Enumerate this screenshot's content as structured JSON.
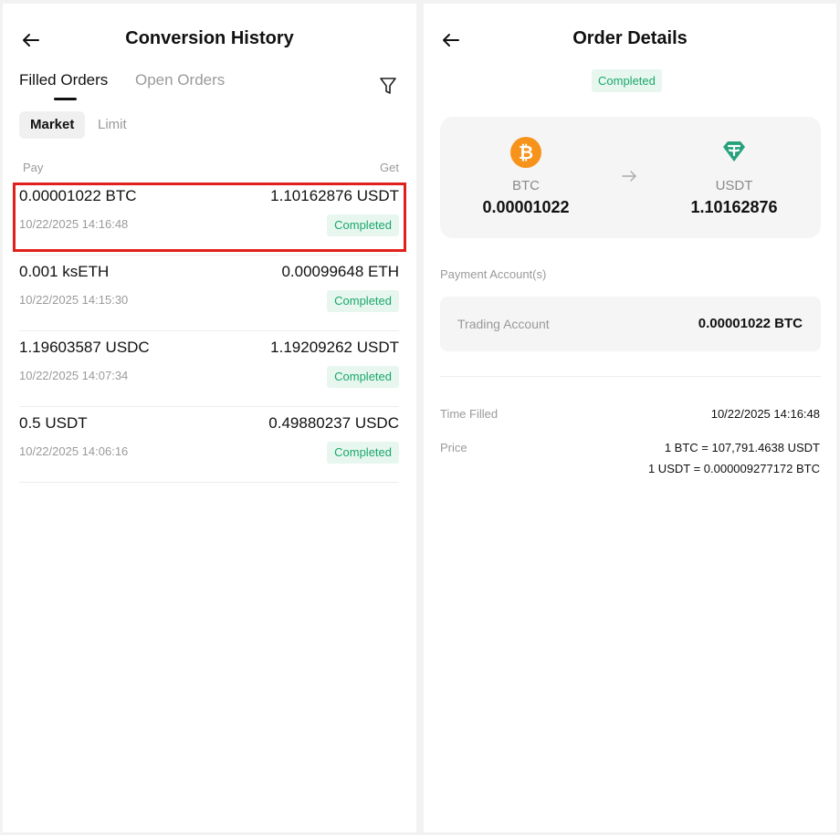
{
  "history": {
    "title": "Conversion History",
    "tabs": [
      "Filled Orders",
      "Open Orders"
    ],
    "filters": [
      "Market",
      "Limit"
    ],
    "columns": {
      "pay": "Pay",
      "get": "Get"
    },
    "rows": [
      {
        "pay": "0.00001022 BTC",
        "get": "1.10162876 USDT",
        "time": "10/22/2025 14:16:48",
        "status": "Completed"
      },
      {
        "pay": "0.001 ksETH",
        "get": "0.00099648 ETH",
        "time": "10/22/2025 14:15:30",
        "status": "Completed"
      },
      {
        "pay": "1.19603587 USDC",
        "get": "1.19209262 USDT",
        "time": "10/22/2025 14:07:34",
        "status": "Completed"
      },
      {
        "pay": "0.5 USDT",
        "get": "0.49880237 USDC",
        "time": "10/22/2025 14:06:16",
        "status": "Completed"
      }
    ]
  },
  "details": {
    "title": "Order Details",
    "status": "Completed",
    "from": {
      "coin": "BTC",
      "amount": "0.00001022"
    },
    "to": {
      "coin": "USDT",
      "amount": "1.10162876"
    },
    "payment_label": "Payment Account(s)",
    "account": {
      "name": "Trading Account",
      "amount": "0.00001022 BTC"
    },
    "time_label": "Time Filled",
    "time_value": "10/22/2025 14:16:48",
    "price_label": "Price",
    "price_values": [
      "1 BTC = 107,791.4638 USDT",
      "1 USDT = 0.000009277172 BTC"
    ]
  },
  "icons": {
    "back": "arrow-left-icon",
    "filter": "funnel-icon",
    "btc": "bitcoin-icon",
    "usdt": "tether-icon",
    "convert": "arrow-right-icon"
  },
  "colors": {
    "accent_green": "#1aa76b",
    "badge_bg": "#e7f7ef",
    "highlight": "#e0201a",
    "btc": "#f7931a",
    "usdt": "#26a17b"
  }
}
